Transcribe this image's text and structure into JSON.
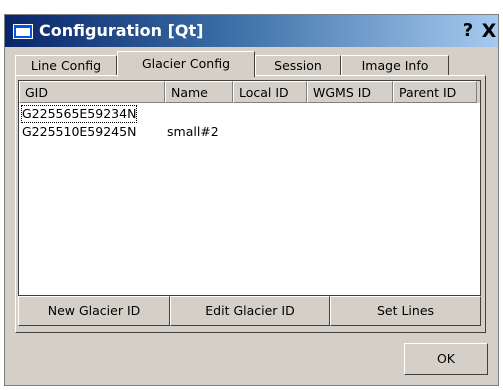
{
  "window": {
    "title": "Configuration [Qt]",
    "help_label": "?",
    "close_label": "X"
  },
  "tabs": [
    {
      "label": "Line Config"
    },
    {
      "label": "Glacier Config"
    },
    {
      "label": "Session"
    },
    {
      "label": "Image Info"
    }
  ],
  "active_tab": "Glacier Config",
  "table": {
    "columns": [
      "GID",
      "Name",
      "Local ID",
      "WGMS ID",
      "Parent ID"
    ],
    "rows": [
      {
        "gid": "G225565E59234N",
        "name": "",
        "local_id": "",
        "wgms_id": "",
        "parent_id": ""
      },
      {
        "gid": "G225510E59245N",
        "name": "small#2",
        "local_id": "",
        "wgms_id": "",
        "parent_id": ""
      }
    ]
  },
  "buttons": {
    "new_glacier": "New Glacier ID",
    "edit_glacier": "Edit Glacier ID",
    "set_lines": "Set Lines",
    "ok": "OK"
  },
  "colors": {
    "titlebar_start": "#0a246a",
    "titlebar_end": "#a6caf0",
    "face": "#d4d0c8"
  }
}
